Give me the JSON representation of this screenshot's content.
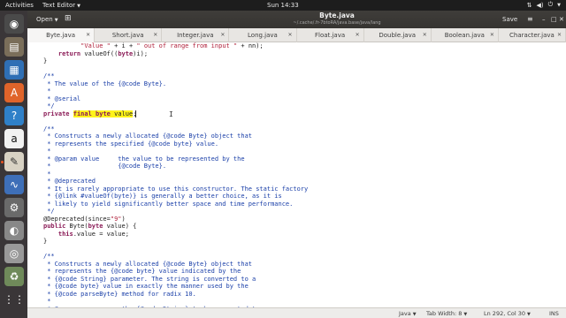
{
  "top_panel": {
    "activities": "Activities",
    "app_menu": "Text Editor",
    "clock": "Sun 14:33"
  },
  "dock": {
    "apps": [
      {
        "name": "chromium-icon",
        "color": "#4a4a4a",
        "glyph": "◉"
      },
      {
        "name": "files-icon",
        "color": "#7a6e5a",
        "glyph": "▤"
      },
      {
        "name": "writer-icon",
        "color": "#2f6fb5",
        "glyph": "▦"
      },
      {
        "name": "ubuntu-software-icon",
        "color": "#e0642a",
        "glyph": "A"
      },
      {
        "name": "help-icon",
        "color": "#2f80c8",
        "glyph": "?"
      },
      {
        "name": "amazon-icon",
        "color": "#f2f2f2",
        "glyph": "a"
      },
      {
        "name": "text-editor-icon",
        "color": "#d8d2c4",
        "glyph": "✎"
      },
      {
        "name": "system-monitor-icon",
        "color": "#3e6fb8",
        "glyph": "∿"
      },
      {
        "name": "settings-icon",
        "color": "#6a6a6a",
        "glyph": "⚙"
      },
      {
        "name": "disk-icon",
        "color": "#888888",
        "glyph": "◐"
      },
      {
        "name": "dvd-icon",
        "color": "#999999",
        "glyph": "◎"
      },
      {
        "name": "trash-icon",
        "color": "#6f8a5a",
        "glyph": "♻"
      },
      {
        "name": "show-apps-icon",
        "color": "#3a3638",
        "glyph": "⋮⋮"
      }
    ]
  },
  "headerbar": {
    "open_label": "Open",
    "title": "Byte.java",
    "path": "~/.cache/.fr-7btoRA/java.base/java/lang",
    "save_label": "Save"
  },
  "tabs": [
    {
      "label": "Byte.java",
      "active": true
    },
    {
      "label": "Short.java",
      "active": false
    },
    {
      "label": "Integer.java",
      "active": false
    },
    {
      "label": "Long.java",
      "active": false
    },
    {
      "label": "Float.java",
      "active": false
    },
    {
      "label": "Double.java",
      "active": false
    },
    {
      "label": "Boolean.java",
      "active": false
    },
    {
      "label": "Character.java",
      "active": false
    }
  ],
  "code_lines": [
    {
      "type": "code",
      "html": "          <span class=\"str\">\"Value \"</span> + i + <span class=\"str\">\" out of range from input \"</span> + nn);"
    },
    {
      "type": "code",
      "html": "    <span class=\"kw\">return</span> valueOf((<span class=\"kw\">byte</span>)i);"
    },
    {
      "type": "code",
      "html": "}"
    },
    {
      "type": "code",
      "html": ""
    },
    {
      "type": "comment",
      "html": "/**"
    },
    {
      "type": "comment",
      "html": " * The value of the {@code Byte}."
    },
    {
      "type": "comment",
      "html": " *"
    },
    {
      "type": "comment",
      "html": " * @serial"
    },
    {
      "type": "comment",
      "html": " */"
    },
    {
      "type": "code",
      "html": "<span class=\"kw\">private</span> <span class=\"hl\"><span class=\"kw\">final</span> <span class=\"kw\">byte</span> value</span>;"
    },
    {
      "type": "code",
      "html": ""
    },
    {
      "type": "comment",
      "html": "/**"
    },
    {
      "type": "comment",
      "html": " * Constructs a newly allocated {@code Byte} object that"
    },
    {
      "type": "comment",
      "html": " * represents the specified {@code byte} value."
    },
    {
      "type": "comment",
      "html": " *"
    },
    {
      "type": "comment",
      "html": " * @param value     the value to be represented by the"
    },
    {
      "type": "comment",
      "html": " *                  {@code Byte}."
    },
    {
      "type": "comment",
      "html": " *"
    },
    {
      "type": "comment",
      "html": " * @deprecated"
    },
    {
      "type": "comment",
      "html": " * It is rarely appropriate to use this constructor. The static factory"
    },
    {
      "type": "comment",
      "html": " * {@link #valueOf(byte)} is generally a better choice, as it is"
    },
    {
      "type": "comment",
      "html": " * likely to yield significantly better space and time performance."
    },
    {
      "type": "comment",
      "html": " */"
    },
    {
      "type": "code",
      "html": "@Deprecated(since=<span class=\"str\">\"9\"</span>)"
    },
    {
      "type": "code",
      "html": "<span class=\"kw\">public</span> Byte(<span class=\"kw\">byte</span> value) {"
    },
    {
      "type": "code",
      "html": "    <span class=\"kw\">this</span>.value = value;"
    },
    {
      "type": "code",
      "html": "}"
    },
    {
      "type": "code",
      "html": ""
    },
    {
      "type": "comment",
      "html": "/**"
    },
    {
      "type": "comment",
      "html": " * Constructs a newly allocated {@code Byte} object that"
    },
    {
      "type": "comment",
      "html": " * represents the {@code byte} value indicated by the"
    },
    {
      "type": "comment",
      "html": " * {@code String} parameter. The string is converted to a"
    },
    {
      "type": "comment",
      "html": " * {@code byte} value in exactly the manner used by the"
    },
    {
      "type": "comment",
      "html": " * {@code parseByte} method for radix 10."
    },
    {
      "type": "comment",
      "html": " *"
    },
    {
      "type": "comment",
      "html": " * @param s          the {@code String} to be converted to a"
    }
  ],
  "statusbar": {
    "language": "Java",
    "tab_width": "Tab Width: 8",
    "position": "Ln 292, Col 30",
    "mode": "INS"
  }
}
